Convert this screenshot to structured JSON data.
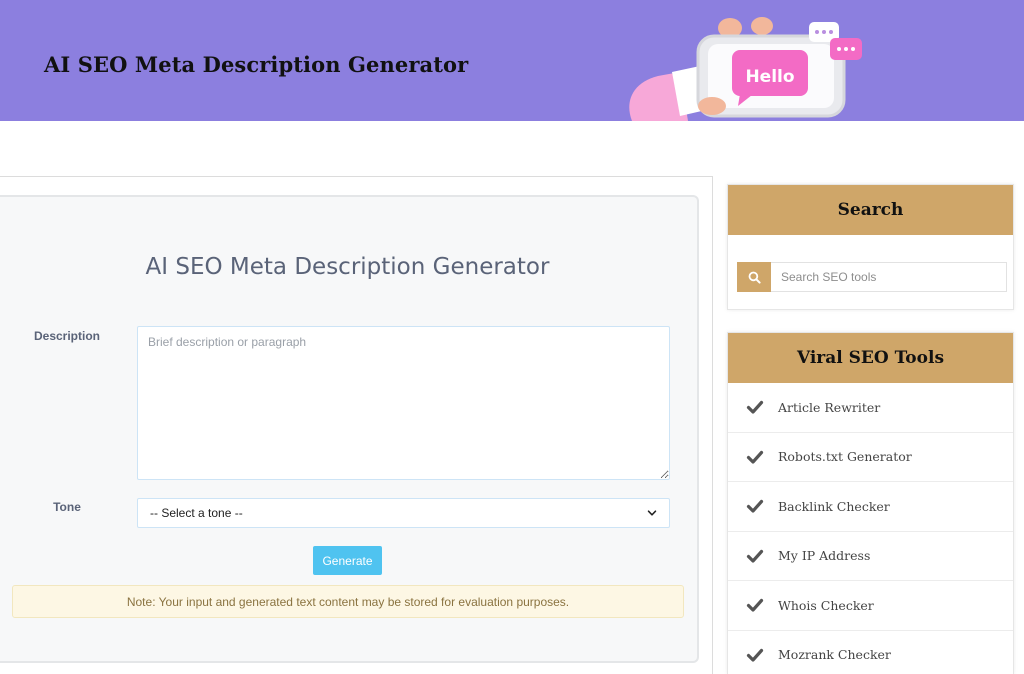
{
  "header": {
    "title": "AI SEO Meta Description Generator",
    "illustration_text": "Hello",
    "bg_color": "#8c7fdf"
  },
  "main": {
    "title": "AI SEO Meta Description Generator",
    "description": {
      "label": "Description",
      "placeholder": "Brief description or paragraph",
      "value": ""
    },
    "tone": {
      "label": "Tone",
      "selected": "-- Select a tone --"
    },
    "generate_label": "Generate",
    "note": "Note: Your input and generated text content may be stored for evaluation purposes."
  },
  "sidebar": {
    "search": {
      "heading": "Search",
      "placeholder": "Search SEO tools",
      "icon": "search-icon"
    },
    "tools": {
      "heading": "Viral SEO Tools",
      "icon": "check-icon",
      "items": [
        {
          "label": "Article Rewriter"
        },
        {
          "label": "Robots.txt Generator"
        },
        {
          "label": "Backlink Checker"
        },
        {
          "label": "My IP Address"
        },
        {
          "label": "Whois Checker"
        },
        {
          "label": "Mozrank Checker"
        }
      ]
    }
  },
  "colors": {
    "accent_gold": "#cfa669",
    "button_blue": "#4fc3f0",
    "note_bg": "#fdf7e4"
  }
}
